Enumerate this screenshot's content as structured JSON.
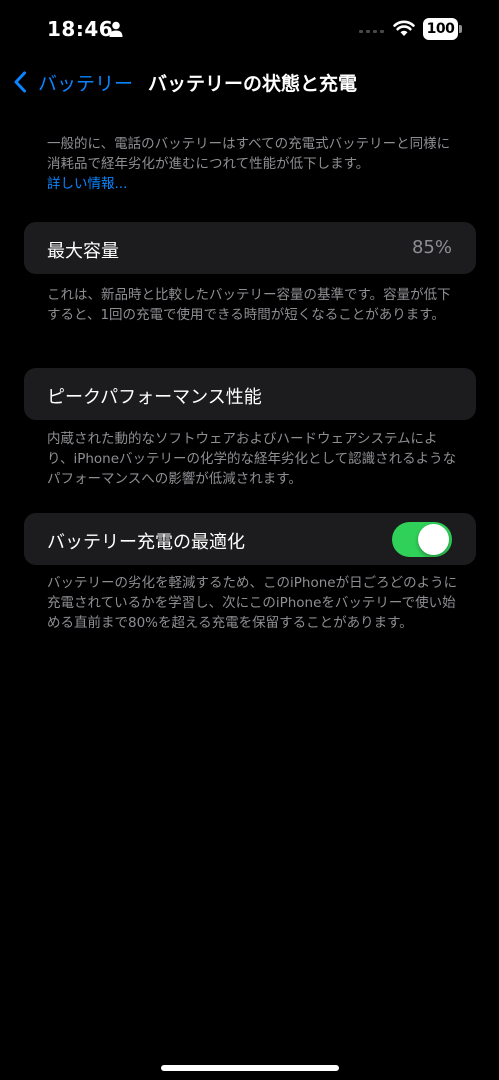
{
  "status_bar": {
    "time": "18:46",
    "battery_level": "100",
    "icons": [
      "person-icon",
      "signal-icon",
      "wifi-icon",
      "battery-icon"
    ]
  },
  "nav": {
    "back_label": "バッテリー",
    "title": "バッテリーの状態と充電"
  },
  "intro": {
    "text": "一般的に、電話のバッテリーはすべての充電式バッテリーと同様に消耗品で経年劣化が進むにつれて性能が低下します。",
    "link": "詳しい情報..."
  },
  "max_capacity": {
    "label": "最大容量",
    "value": "85%",
    "footer": "これは、新品時と比較したバッテリー容量の基準です。容量が低下すると、1回の充電で使用できる時間が短くなることがあります。"
  },
  "peak_performance": {
    "label": "ピークパフォーマンス性能",
    "footer": "内蔵された動的なソフトウェアおよびハードウェアシステムにより、iPhoneバッテリーの化学的な経年劣化として認識されるようなパフォーマンスへの影響が低減されます。"
  },
  "optimized_charging": {
    "label": "バッテリー充電の最適化",
    "enabled": true,
    "footer": "バッテリーの劣化を軽減するため、このiPhoneが日ごろどのように充電されているかを学習し、次にこのiPhoneをバッテリーで使い始める直前まで80%を超える充電を保留することがあります。"
  },
  "colors": {
    "background": "#000000",
    "cell": "#1c1c1e",
    "accent": "#0a84ff",
    "toggle_on": "#30d158",
    "secondary_text": "#8e8e93"
  }
}
